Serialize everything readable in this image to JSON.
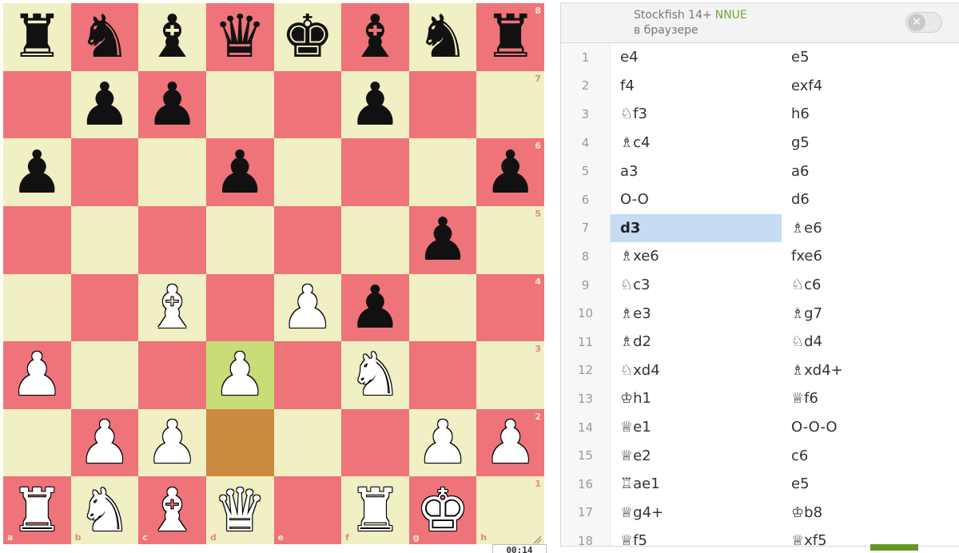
{
  "board": {
    "ranks": [
      [
        "bR",
        "bN",
        "bB",
        "bQ",
        "bK",
        "bB",
        "bN",
        "bR"
      ],
      [
        "",
        "bP",
        "bP",
        "",
        "",
        "bP",
        "",
        ""
      ],
      [
        "bP",
        "",
        "",
        "bP",
        "",
        "",
        "",
        "bP"
      ],
      [
        "",
        "",
        "",
        "",
        "",
        "",
        "bP",
        ""
      ],
      [
        "",
        "",
        "wB",
        "",
        "wP",
        "bP",
        "",
        ""
      ],
      [
        "wP",
        "",
        "",
        "wP",
        "",
        "wN",
        "",
        ""
      ],
      [
        "",
        "wP",
        "wP",
        "",
        "",
        "",
        "wP",
        "wP"
      ],
      [
        "wR",
        "wN",
        "wB",
        "wQ",
        "",
        "wR",
        "wK",
        ""
      ]
    ],
    "last_move_from": "d2",
    "last_move_to": "d3",
    "rank_labels": [
      "8",
      "7",
      "6",
      "5",
      "4",
      "3",
      "2",
      "1"
    ],
    "file_labels": [
      "a",
      "b",
      "c",
      "d",
      "e",
      "f",
      "g",
      "h"
    ],
    "colors": {
      "light": "#f1efc4",
      "dark": "#ee7479",
      "highlight_to": "#c8dc77",
      "highlight_from": "#cc8a3f"
    }
  },
  "clock": {
    "time": "00:14"
  },
  "engine": {
    "name": "Stockfish 14+",
    "tag": "NNUE",
    "subtitle": "в браузере",
    "toggle_symbol": "✕"
  },
  "moves": [
    {
      "n": "1",
      "w": "e4",
      "b": "e5"
    },
    {
      "n": "2",
      "w": "f4",
      "b": "exf4"
    },
    {
      "n": "3",
      "w": "♘f3",
      "b": "h6"
    },
    {
      "n": "4",
      "w": "♗c4",
      "b": "g5"
    },
    {
      "n": "5",
      "w": "a3",
      "b": "a6"
    },
    {
      "n": "6",
      "w": "O-O",
      "b": "d6"
    },
    {
      "n": "7",
      "w": "d3",
      "b": "♗e6"
    },
    {
      "n": "8",
      "w": "♗xe6",
      "b": "fxe6"
    },
    {
      "n": "9",
      "w": "♘c3",
      "b": "♘c6"
    },
    {
      "n": "10",
      "w": "♗e3",
      "b": "♗g7"
    },
    {
      "n": "11",
      "w": "♗d2",
      "b": "♘d4"
    },
    {
      "n": "12",
      "w": "♘xd4",
      "b": "♗xd4+"
    },
    {
      "n": "13",
      "w": "♔h1",
      "b": "♕f6"
    },
    {
      "n": "14",
      "w": "♕e1",
      "b": "O-O-O"
    },
    {
      "n": "15",
      "w": "♕e2",
      "b": "c6"
    },
    {
      "n": "16",
      "w": "♖ae1",
      "b": "e5"
    },
    {
      "n": "17",
      "w": "♕g4+",
      "b": "♔b8"
    },
    {
      "n": "18",
      "w": "♕f5",
      "b": "♕xf5"
    }
  ],
  "active_move": {
    "row": 6,
    "side": "w"
  }
}
